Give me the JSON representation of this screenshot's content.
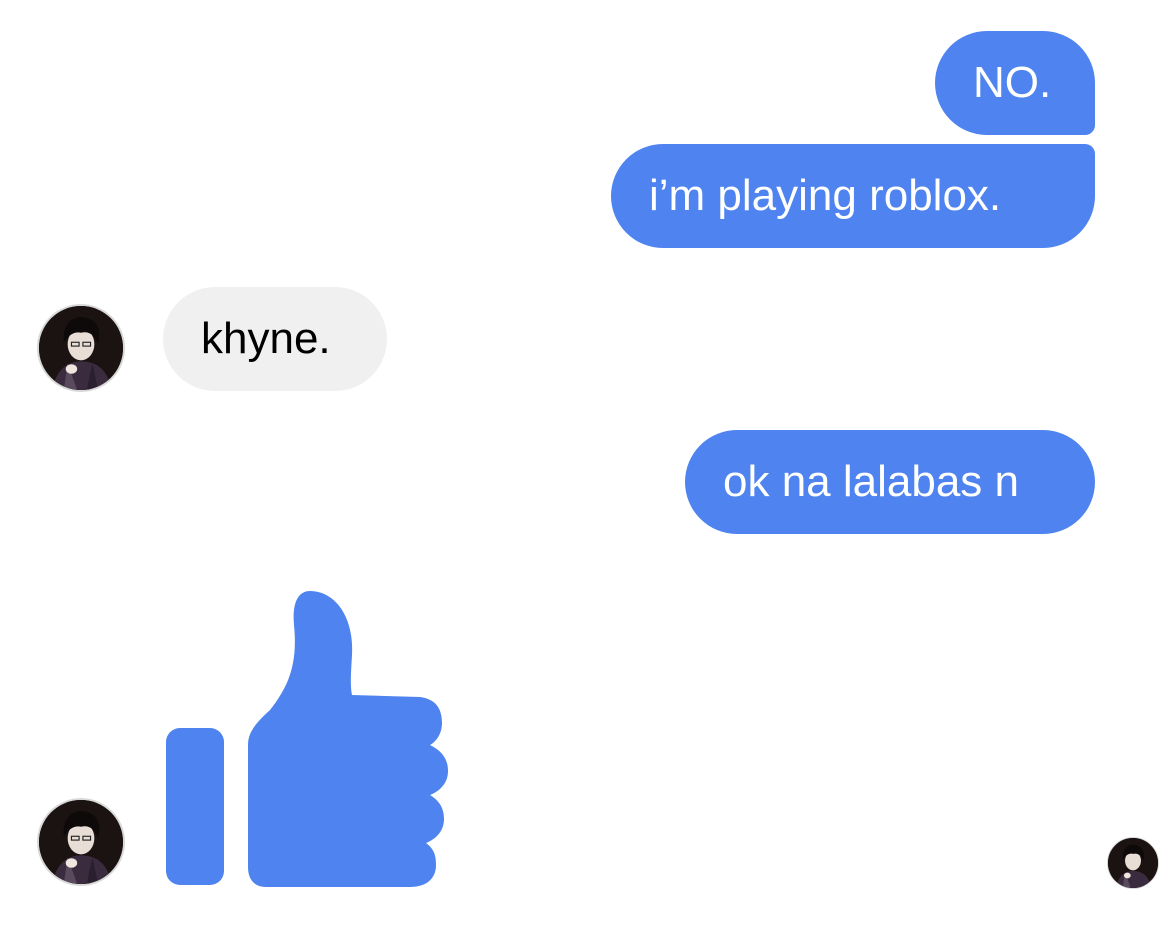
{
  "conversation": {
    "accent_color": "#4f83ef",
    "incoming_bubble_color": "#f0f0f0",
    "messages": [
      {
        "sender": "me",
        "text": "NO."
      },
      {
        "sender": "me",
        "text": "i’m playing roblox."
      },
      {
        "sender": "contact",
        "text": "khyne."
      },
      {
        "sender": "me",
        "text": "ok na lalabas n"
      },
      {
        "sender": "contact",
        "type": "sticker",
        "icon": "thumbs-up-icon"
      }
    ],
    "read_receipt": {
      "icon": "avatar"
    }
  }
}
